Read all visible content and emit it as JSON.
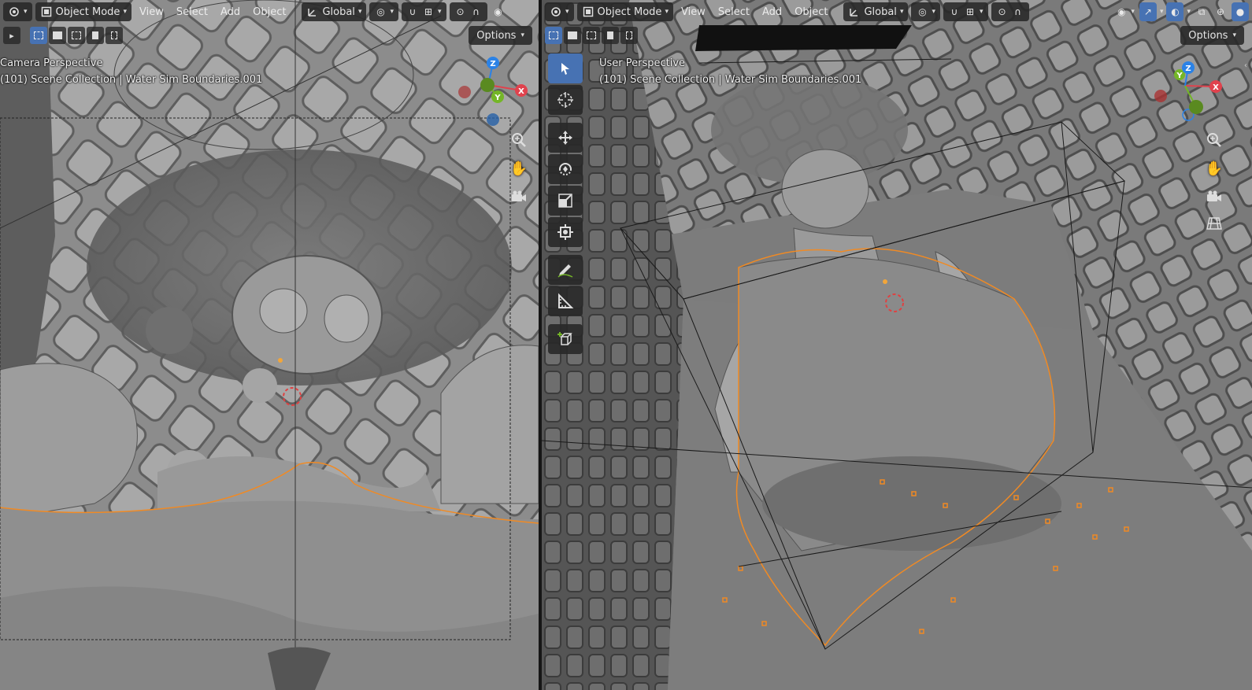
{
  "left": {
    "header": {
      "mode_label": "Object Mode",
      "menu_view": "View",
      "menu_select": "Select",
      "menu_add": "Add",
      "menu_object": "Object",
      "orientation_label": "Global"
    },
    "options_label": "Options",
    "info": {
      "view_name": "Camera Perspective",
      "collection_line": "(101) Scene Collection | Water Sim Boundaries.001"
    },
    "gizmo": {
      "x": "X",
      "y": "Y",
      "z": "Z"
    }
  },
  "right": {
    "header": {
      "mode_label": "Object Mode",
      "menu_view": "View",
      "menu_select": "Select",
      "menu_add": "Add",
      "menu_object": "Object",
      "orientation_label": "Global"
    },
    "options_label": "Options",
    "info": {
      "view_name": "User Perspective",
      "collection_line": "(101) Scene Collection | Water Sim Boundaries.001"
    },
    "gizmo": {
      "x": "X",
      "y": "Y",
      "z": "Z"
    },
    "tools": [
      "select-box-tool",
      "cursor-tool",
      "move-tool",
      "rotate-tool",
      "scale-tool",
      "transform-tool",
      "annotate-tool",
      "measure-tool",
      "add-cube-tool"
    ]
  },
  "colors": {
    "accent": "#4772b3",
    "axis_x": "#e0424d",
    "axis_y": "#74b627",
    "axis_z": "#2b82e6",
    "selection_outline": "#f08a24",
    "viewport_bg": "#7e7e7e",
    "header_bg": "#282828"
  }
}
